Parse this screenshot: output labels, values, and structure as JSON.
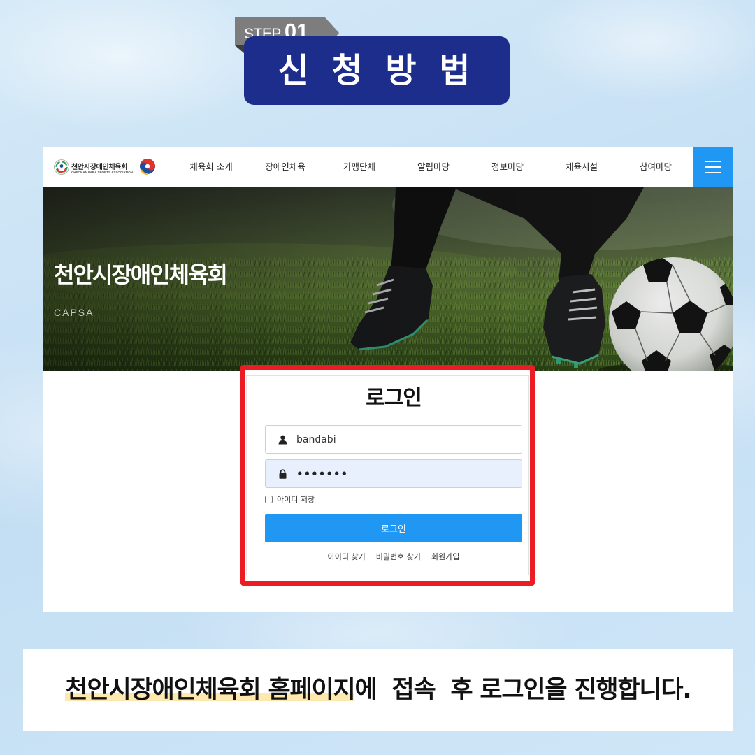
{
  "step": {
    "label": "STEP",
    "number": "01"
  },
  "heading": "신 청 방 법",
  "site": {
    "logo": {
      "title": "천안시장애인체육회",
      "subtitle": "CHEONAN PARA SPORTS ASSOCIATION",
      "emblem_icon": "emblem-icon",
      "mark_icon": "taeguk-icon"
    },
    "nav": [
      "체육회 소개",
      "장애인체육",
      "가맹단체",
      "알림마당",
      "정보마당",
      "체육시설",
      "참여마당"
    ],
    "menu_icon": "hamburger-icon",
    "hero": {
      "title": "천안시장애인체육회",
      "subtitle": "CAPSA"
    },
    "login": {
      "title": "로그인",
      "username": {
        "value": "bandabi",
        "icon": "user-icon"
      },
      "password": {
        "value": "•••••••",
        "icon": "lock-icon"
      },
      "remember_label": "아이디 저장",
      "remember_checked": false,
      "submit_label": "로그인",
      "links": [
        "아이디 찾기",
        "비밀번호 찾기",
        "회원가입"
      ]
    }
  },
  "caption": {
    "highlight": "천안시장애인체육회 홈페이지",
    "rest": "에  접속  후 로그인을 진행합니다."
  },
  "colors": {
    "background": "#c9e2f5",
    "heading_box": "#1c2d8c",
    "step_tag": "#7d7d7d",
    "accent_blue": "#1f97f3",
    "highlight_frame": "#ec1c24",
    "caption_highlight": "#fde8ad",
    "autofill": "#e8f0fe"
  }
}
